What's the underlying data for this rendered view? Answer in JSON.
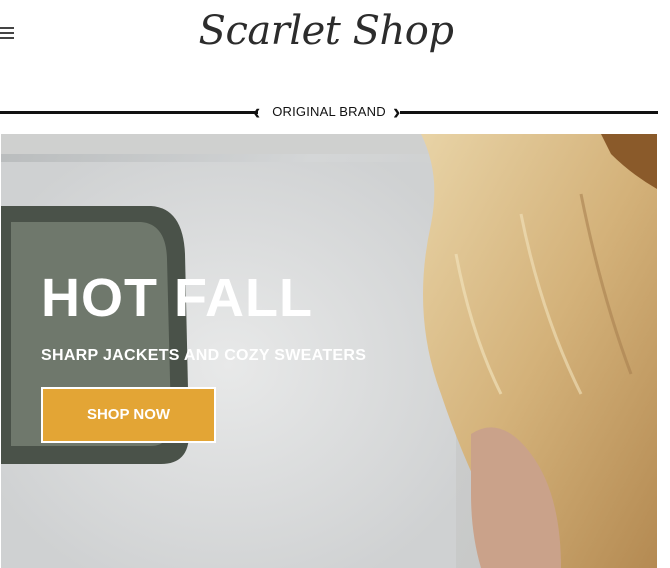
{
  "header": {
    "menu_icon": "hamburger-menu-icon",
    "logo_text": "Scarlet Shop"
  },
  "brand_bar": {
    "label": "ORIGINAL BRAND",
    "left_icon": "chevron-left-icon",
    "right_icon": "chevron-right-icon"
  },
  "hero": {
    "title": "HOT FALL",
    "subtitle": "SHARP JACKETS AND COZY SWEATERS",
    "cta_label": "SHOP NOW",
    "colors": {
      "cta_background": "#e3a535",
      "text": "#ffffff"
    }
  }
}
